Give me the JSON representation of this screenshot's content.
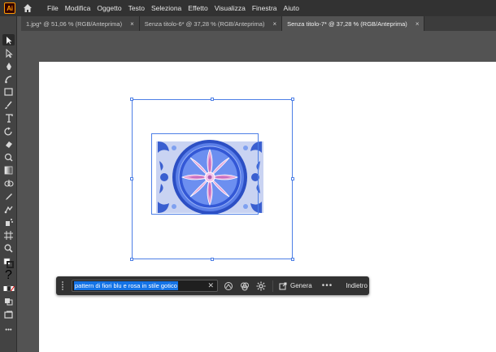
{
  "app": {
    "logo_text": "Ai",
    "menu": [
      "File",
      "Modifica",
      "Oggetto",
      "Testo",
      "Seleziona",
      "Effetto",
      "Visualizza",
      "Finestra",
      "Aiuto"
    ]
  },
  "tabs": [
    {
      "label": "1.jpg* @ 51,06 % (RGB/Anteprima)",
      "close": "×",
      "active": false
    },
    {
      "label": "Senza titolo-6* @ 37,28 % (RGB/Anteprima)",
      "close": "×",
      "active": false
    },
    {
      "label": "Senza titolo-7* @ 37,28 % (RGB/Anteprima)",
      "close": "×",
      "active": true
    }
  ],
  "taskbar": {
    "prompt_value": "pattern di fiori blu e rosa in stile gotico",
    "clear": "✕",
    "generate_label": "Genera",
    "more": "•••",
    "back_label": "Indietro"
  },
  "toolbar": {
    "icons": [
      "selection-tool-icon",
      "direct-selection-icon",
      "pen-icon",
      "curvature-icon",
      "rectangle-icon",
      "paintbrush-icon",
      "type-icon",
      "rotate-icon",
      "eraser-icon",
      "warp-icon",
      "gradient-icon",
      "shape-builder-icon",
      "eyedropper-icon",
      "blend-icon",
      "symbol-sprayer-icon",
      "artboard-icon",
      "zoom-icon",
      "hand-icon",
      "fill-stroke-icon",
      "drawing-modes-icon",
      "screen-mode-icon",
      "more-tools-icon"
    ],
    "help_glyph": "?",
    "more_glyph": "•••"
  },
  "colors": {
    "menubar": "#323232",
    "workspace": "#535353",
    "selection": "#4d7fe6",
    "highlight": "#1473e6",
    "ai_orange": "#ff9a00"
  }
}
